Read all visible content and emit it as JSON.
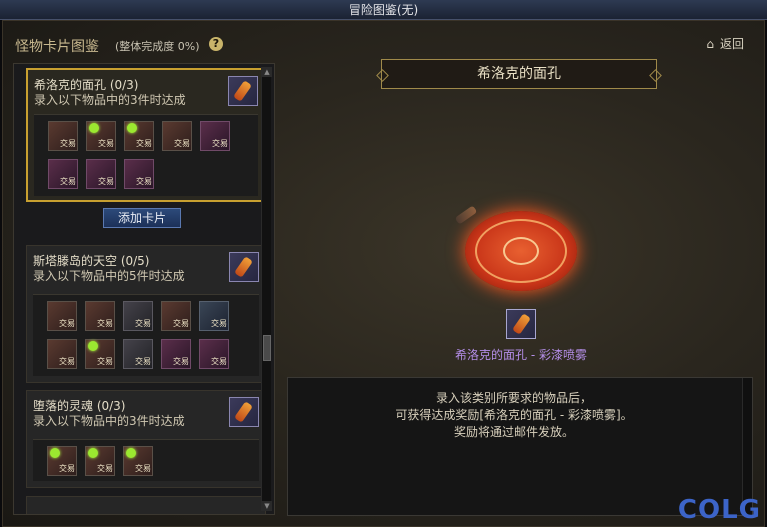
{
  "window_title": "冒险图鉴(无)",
  "header": {
    "title": "怪物卡片图鉴",
    "subtitle": "(整体完成度 0%)",
    "help": "?"
  },
  "nav": {
    "back_label": "返回"
  },
  "cards": [
    {
      "name": "希洛克的面孔 (0/3)",
      "desc": "录入以下物品中的3件时达成",
      "items": [
        {
          "color": "brown",
          "gem": false
        },
        {
          "color": "brown",
          "gem": true
        },
        {
          "color": "brown",
          "gem": true
        },
        {
          "color": "brown",
          "gem": false
        },
        {
          "color": "purple",
          "gem": false
        },
        {
          "color": "purple",
          "gem": false
        },
        {
          "color": "purple",
          "gem": false
        },
        {
          "color": "purple",
          "gem": false
        }
      ]
    },
    {
      "name": "斯塔滕岛的天空 (0/5)",
      "desc": "录入以下物品中的5件时达成",
      "items": [
        {
          "color": "brown",
          "gem": false
        },
        {
          "color": "brown",
          "gem": false
        },
        {
          "color": "gray",
          "gem": false
        },
        {
          "color": "brown",
          "gem": false
        },
        {
          "color": "blue",
          "gem": false
        },
        {
          "color": "brown",
          "gem": false
        },
        {
          "color": "brown",
          "gem": true
        },
        {
          "color": "gray",
          "gem": false
        },
        {
          "color": "purple",
          "gem": false
        },
        {
          "color": "purple",
          "gem": false
        }
      ]
    },
    {
      "name": "堕落的灵魂 (0/3)",
      "desc": "录入以下物品中的3件时达成",
      "items": [
        {
          "color": "brown",
          "gem": true
        },
        {
          "color": "brown",
          "gem": true
        },
        {
          "color": "brown",
          "gem": true
        }
      ]
    }
  ],
  "trade_label": "交易",
  "add_card_label": "添加卡片",
  "detail": {
    "title": "希洛克的面孔",
    "reward_name": "希洛克的面孔 - 彩漆喷雾",
    "desc_lines": [
      "录入该类别所要求的物品后，",
      "可获得达成奖励[希洛克的面孔 - 彩漆喷雾]。",
      "奖励将通过邮件发放。"
    ]
  },
  "watermark": "COLG"
}
